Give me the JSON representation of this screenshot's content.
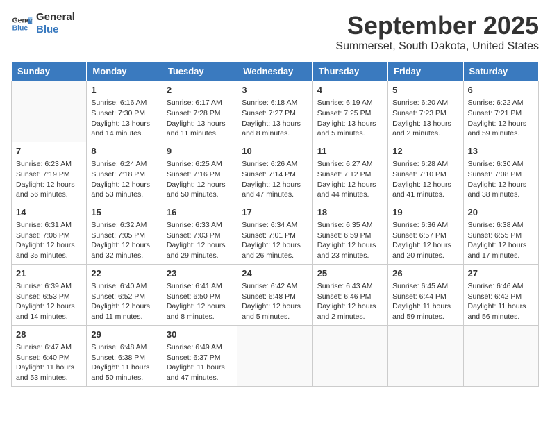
{
  "header": {
    "logo_line1": "General",
    "logo_line2": "Blue",
    "month": "September 2025",
    "location": "Summerset, South Dakota, United States"
  },
  "weekdays": [
    "Sunday",
    "Monday",
    "Tuesday",
    "Wednesday",
    "Thursday",
    "Friday",
    "Saturday"
  ],
  "weeks": [
    [
      {
        "day": "",
        "info": ""
      },
      {
        "day": "1",
        "info": "Sunrise: 6:16 AM\nSunset: 7:30 PM\nDaylight: 13 hours\nand 14 minutes."
      },
      {
        "day": "2",
        "info": "Sunrise: 6:17 AM\nSunset: 7:28 PM\nDaylight: 13 hours\nand 11 minutes."
      },
      {
        "day": "3",
        "info": "Sunrise: 6:18 AM\nSunset: 7:27 PM\nDaylight: 13 hours\nand 8 minutes."
      },
      {
        "day": "4",
        "info": "Sunrise: 6:19 AM\nSunset: 7:25 PM\nDaylight: 13 hours\nand 5 minutes."
      },
      {
        "day": "5",
        "info": "Sunrise: 6:20 AM\nSunset: 7:23 PM\nDaylight: 13 hours\nand 2 minutes."
      },
      {
        "day": "6",
        "info": "Sunrise: 6:22 AM\nSunset: 7:21 PM\nDaylight: 12 hours\nand 59 minutes."
      }
    ],
    [
      {
        "day": "7",
        "info": "Sunrise: 6:23 AM\nSunset: 7:19 PM\nDaylight: 12 hours\nand 56 minutes."
      },
      {
        "day": "8",
        "info": "Sunrise: 6:24 AM\nSunset: 7:18 PM\nDaylight: 12 hours\nand 53 minutes."
      },
      {
        "day": "9",
        "info": "Sunrise: 6:25 AM\nSunset: 7:16 PM\nDaylight: 12 hours\nand 50 minutes."
      },
      {
        "day": "10",
        "info": "Sunrise: 6:26 AM\nSunset: 7:14 PM\nDaylight: 12 hours\nand 47 minutes."
      },
      {
        "day": "11",
        "info": "Sunrise: 6:27 AM\nSunset: 7:12 PM\nDaylight: 12 hours\nand 44 minutes."
      },
      {
        "day": "12",
        "info": "Sunrise: 6:28 AM\nSunset: 7:10 PM\nDaylight: 12 hours\nand 41 minutes."
      },
      {
        "day": "13",
        "info": "Sunrise: 6:30 AM\nSunset: 7:08 PM\nDaylight: 12 hours\nand 38 minutes."
      }
    ],
    [
      {
        "day": "14",
        "info": "Sunrise: 6:31 AM\nSunset: 7:06 PM\nDaylight: 12 hours\nand 35 minutes."
      },
      {
        "day": "15",
        "info": "Sunrise: 6:32 AM\nSunset: 7:05 PM\nDaylight: 12 hours\nand 32 minutes."
      },
      {
        "day": "16",
        "info": "Sunrise: 6:33 AM\nSunset: 7:03 PM\nDaylight: 12 hours\nand 29 minutes."
      },
      {
        "day": "17",
        "info": "Sunrise: 6:34 AM\nSunset: 7:01 PM\nDaylight: 12 hours\nand 26 minutes."
      },
      {
        "day": "18",
        "info": "Sunrise: 6:35 AM\nSunset: 6:59 PM\nDaylight: 12 hours\nand 23 minutes."
      },
      {
        "day": "19",
        "info": "Sunrise: 6:36 AM\nSunset: 6:57 PM\nDaylight: 12 hours\nand 20 minutes."
      },
      {
        "day": "20",
        "info": "Sunrise: 6:38 AM\nSunset: 6:55 PM\nDaylight: 12 hours\nand 17 minutes."
      }
    ],
    [
      {
        "day": "21",
        "info": "Sunrise: 6:39 AM\nSunset: 6:53 PM\nDaylight: 12 hours\nand 14 minutes."
      },
      {
        "day": "22",
        "info": "Sunrise: 6:40 AM\nSunset: 6:52 PM\nDaylight: 12 hours\nand 11 minutes."
      },
      {
        "day": "23",
        "info": "Sunrise: 6:41 AM\nSunset: 6:50 PM\nDaylight: 12 hours\nand 8 minutes."
      },
      {
        "day": "24",
        "info": "Sunrise: 6:42 AM\nSunset: 6:48 PM\nDaylight: 12 hours\nand 5 minutes."
      },
      {
        "day": "25",
        "info": "Sunrise: 6:43 AM\nSunset: 6:46 PM\nDaylight: 12 hours\nand 2 minutes."
      },
      {
        "day": "26",
        "info": "Sunrise: 6:45 AM\nSunset: 6:44 PM\nDaylight: 11 hours\nand 59 minutes."
      },
      {
        "day": "27",
        "info": "Sunrise: 6:46 AM\nSunset: 6:42 PM\nDaylight: 11 hours\nand 56 minutes."
      }
    ],
    [
      {
        "day": "28",
        "info": "Sunrise: 6:47 AM\nSunset: 6:40 PM\nDaylight: 11 hours\nand 53 minutes."
      },
      {
        "day": "29",
        "info": "Sunrise: 6:48 AM\nSunset: 6:38 PM\nDaylight: 11 hours\nand 50 minutes."
      },
      {
        "day": "30",
        "info": "Sunrise: 6:49 AM\nSunset: 6:37 PM\nDaylight: 11 hours\nand 47 minutes."
      },
      {
        "day": "",
        "info": ""
      },
      {
        "day": "",
        "info": ""
      },
      {
        "day": "",
        "info": ""
      },
      {
        "day": "",
        "info": ""
      }
    ]
  ]
}
